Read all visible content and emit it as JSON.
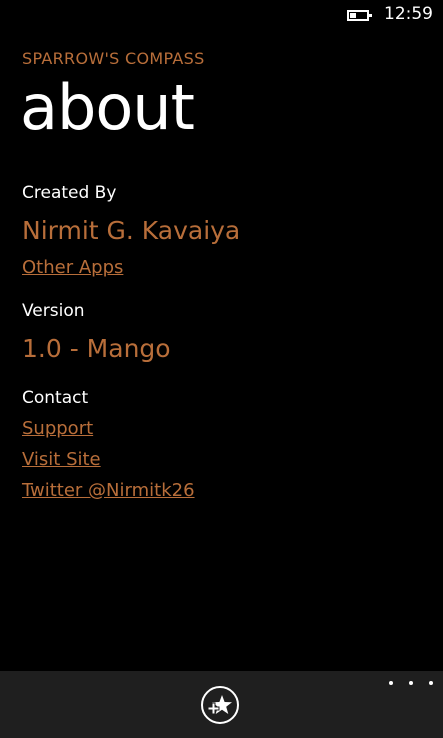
{
  "status_bar": {
    "time": "12:59",
    "battery_level_percent": 35
  },
  "app_title": "SPARROW'S COMPASS",
  "page_title": "about",
  "created_by": {
    "label": "Created By",
    "name": "Nirmit G. Kavaiya",
    "link": "Other Apps"
  },
  "version": {
    "label": "Version",
    "value": "1.0 - Mango"
  },
  "contact": {
    "label": "Contact",
    "links": [
      "Support",
      "Visit Site",
      "Twitter @Nirmitk26"
    ]
  },
  "app_bar": {
    "button_icon": "star-add-icon",
    "more_icon": "ellipsis-icon"
  },
  "colors": {
    "accent": "#b86e3a",
    "background": "#000000",
    "app_bar": "#1f1f1f"
  }
}
